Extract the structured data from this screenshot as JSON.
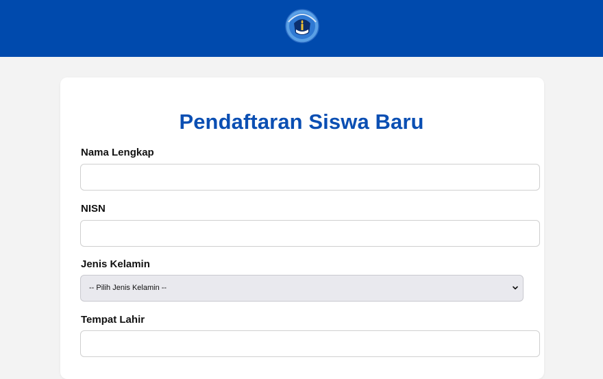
{
  "header": {
    "logo_icon": "tut-wuri-handayani-logo",
    "brand_color": "#004aad"
  },
  "form": {
    "title": "Pendaftaran Siswa Baru",
    "fields": [
      {
        "label": "Nama Lengkap",
        "value": "",
        "placeholder": ""
      },
      {
        "label": "NISN",
        "value": "",
        "placeholder": ""
      },
      {
        "label": "Jenis Kelamin",
        "selected": "-- Pilih Jenis Kelamin --"
      },
      {
        "label": "Tempat Lahir",
        "value": "",
        "placeholder": ""
      }
    ],
    "title_color": "#0b4fb3"
  }
}
